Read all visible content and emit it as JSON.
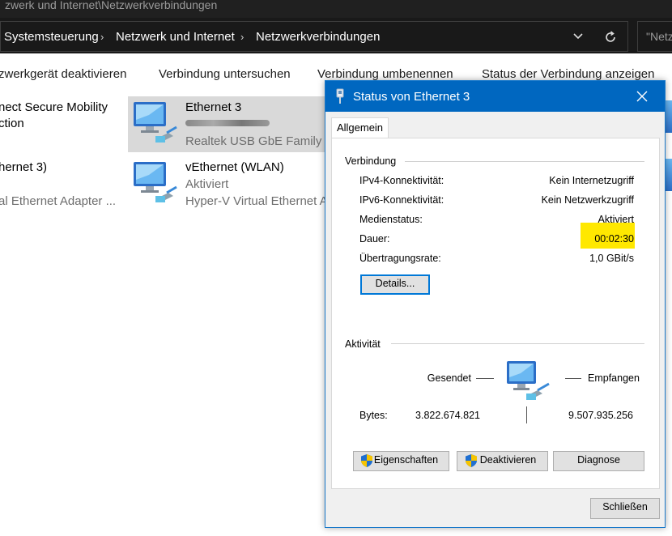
{
  "window": {
    "title": "zwerk und Internet\\Netzwerkverbindungen"
  },
  "address_bar": {
    "crumbs": [
      "Systemsteuerung",
      "Netzwerk und Internet",
      "Netzwerkverbindungen"
    ],
    "search_placeholder": "\"Netz"
  },
  "toolbar": {
    "items": [
      "zwerkgerät deaktivieren",
      "Verbindung untersuchen",
      "Verbindung umbenennen",
      "Status der Verbindung anzeigen"
    ]
  },
  "connections": [
    {
      "name": "nect Secure Mobility",
      "line2": "ction",
      "line3": ""
    },
    {
      "name": "hernet 3)",
      "line2": "",
      "line3": "al Ethernet Adapter ..."
    },
    {
      "name": "Ethernet 3",
      "line2": "",
      "line3": "Realtek USB GbE Family Co"
    },
    {
      "name": "vEthernet (WLAN)",
      "line2": "Aktiviert",
      "line3": "Hyper-V Virtual Ethernet A"
    }
  ],
  "dialog": {
    "title": "Status von Ethernet 3",
    "tab": "Allgemein",
    "section_connection": "Verbindung",
    "rows": [
      {
        "label": "IPv4-Konnektivität:",
        "value": "Kein Internetzugriff"
      },
      {
        "label": "IPv6-Konnektivität:",
        "value": "Kein Netzwerkzugriff"
      },
      {
        "label": "Medienstatus:",
        "value": "Aktiviert"
      },
      {
        "label": "Dauer:",
        "value": "00:02:30"
      },
      {
        "label": "Übertragungsrate:",
        "value": "1,0 GBit/s"
      }
    ],
    "details_button": "Details...",
    "section_activity": "Aktivität",
    "sent_label": "Gesendet",
    "received_label": "Empfangen",
    "bytes_label": "Bytes:",
    "bytes_sent": "3.822.674.821",
    "bytes_received": "9.507.935.256",
    "buttons": {
      "properties": "Eigenschaften",
      "disable": "Deaktivieren",
      "diagnose": "Diagnose",
      "close": "Schließen"
    }
  },
  "colors": {
    "titlebar_blue": "#0067c0",
    "highlight_yellow": "#ffe800",
    "dark_chrome": "#191919"
  }
}
